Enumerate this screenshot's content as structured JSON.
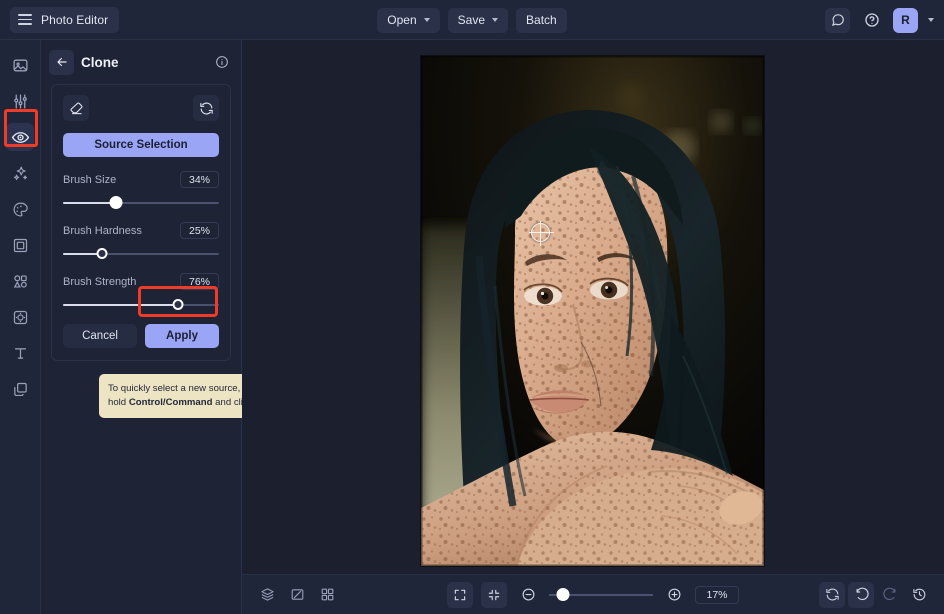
{
  "app": {
    "title": "Photo Editor",
    "accent": "#9aa5f5",
    "annotation_color": "#ef3b27",
    "bg": "#1b1f2e",
    "panel_bg": "#1e2335",
    "bar_bg": "#20263a"
  },
  "topbar": {
    "menu_icon": "hamburger-icon",
    "buttons": [
      {
        "label": "Open",
        "has_chevron": true
      },
      {
        "label": "Save",
        "has_chevron": true
      },
      {
        "label": "Batch",
        "has_chevron": false
      }
    ],
    "right": {
      "feedback_icon": "comment-icon",
      "help_icon": "help-circle-icon",
      "avatar_initial": "R",
      "avatar_chevron": "chevron-down-icon"
    }
  },
  "rail": {
    "items": [
      {
        "name": "image-icon",
        "label": "Image",
        "active": false
      },
      {
        "name": "sliders-icon",
        "label": "Adjust",
        "active": false
      },
      {
        "name": "eye-icon",
        "label": "Retouch",
        "active": true
      },
      {
        "name": "sparkles-icon",
        "label": "AI Tools",
        "active": false
      },
      {
        "name": "palette-icon",
        "label": "Color",
        "active": false
      },
      {
        "name": "frame-icon",
        "label": "Frame",
        "active": false
      },
      {
        "name": "shapes-icon",
        "label": "Shapes",
        "active": false
      },
      {
        "name": "effects-icon",
        "label": "Effects",
        "active": false
      },
      {
        "name": "text-icon",
        "label": "Text",
        "active": false
      },
      {
        "name": "layers-icon",
        "label": "Layers",
        "active": false
      }
    ],
    "highlighted_index": 2
  },
  "panel": {
    "back_icon": "arrow-left-icon",
    "title": "Clone",
    "info_icon": "info-circle-icon",
    "tools": {
      "brush_icon": "eraser-icon",
      "reset_icon": "refresh-icon"
    },
    "source_button": "Source Selection",
    "sliders": [
      {
        "label": "Brush Size",
        "value": "34%",
        "percent": 34,
        "hovered": true
      },
      {
        "label": "Brush Hardness",
        "value": "25%",
        "percent": 25,
        "hovered": false
      },
      {
        "label": "Brush Strength",
        "value": "76%",
        "percent": 76,
        "hovered": false
      }
    ],
    "cancel_label": "Cancel",
    "apply_label": "Apply",
    "tooltip": {
      "line1_prefix": "To quickly select a new source, hold ",
      "emphasis": "Control/Command",
      "line1_suffix": " and click."
    }
  },
  "canvas": {
    "cursor_icon": "clone-source-crosshair-icon",
    "image_description": "Portrait photograph of a young woman with freckles, dark teal-black hair, resting chin on crossed arms"
  },
  "bottombar": {
    "left_tools": [
      {
        "name": "layers-stack-icon",
        "label": "Layers"
      },
      {
        "name": "compare-icon",
        "label": "Compare"
      },
      {
        "name": "grid-icon",
        "label": "Grid"
      }
    ],
    "view_tools": [
      {
        "name": "fit-screen-icon",
        "label": "Fit to screen"
      },
      {
        "name": "actual-size-icon",
        "label": "Actual size"
      }
    ],
    "zoom_out_icon": "zoom-out-icon",
    "zoom_in_icon": "zoom-in-icon",
    "zoom_value": "17%",
    "zoom_percent": 13,
    "right_tools": [
      {
        "name": "reset-view-icon",
        "label": "Reset",
        "dim": false
      },
      {
        "name": "undo-icon",
        "label": "Undo",
        "dim": false
      },
      {
        "name": "redo-icon",
        "label": "Redo",
        "dim": true
      },
      {
        "name": "history-icon",
        "label": "History",
        "dim": false
      }
    ]
  }
}
